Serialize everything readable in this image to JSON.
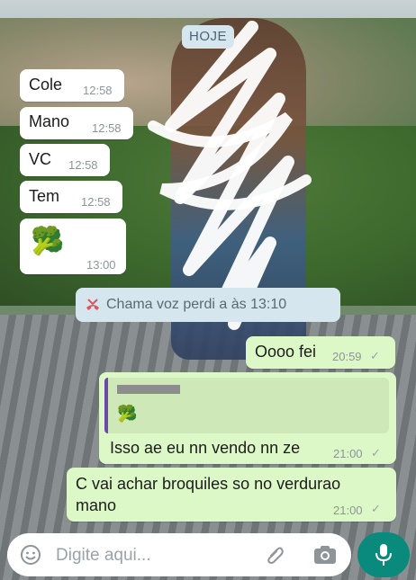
{
  "chat": {
    "date_label": "HOJE",
    "messages_in": [
      {
        "text": "Cole",
        "time": "12:58"
      },
      {
        "text": "Mano",
        "time": "12:58"
      },
      {
        "text": "VC",
        "time": "12:58"
      },
      {
        "text": "Tem",
        "time": "12:58"
      },
      {
        "text": "🥦",
        "time": "13:00"
      }
    ],
    "call_notice": "Chama   voz   perdi a às 13:10",
    "messages_out": [
      {
        "text": "Oooo fei",
        "time": "20:59"
      },
      {
        "quoted_icon": "broccoli-emoji",
        "text": "Isso ae eu nn vendo nn ze",
        "time": "21:00"
      },
      {
        "text": "C vai achar broquiles so no verdurao",
        "text2": "mano",
        "time": "21:00"
      }
    ]
  },
  "input": {
    "placeholder": "Digite aqui..."
  },
  "colors": {
    "incoming": "#ffffff",
    "outgoing": "#dcf8c6",
    "mic_button": "#0a8a7d",
    "date_chip": "#d6e6ee"
  },
  "icons": [
    "emoji-icon",
    "attach-clip-icon",
    "camera-icon",
    "mic-icon",
    "missed-call-icon",
    "read-tick-icon"
  ]
}
